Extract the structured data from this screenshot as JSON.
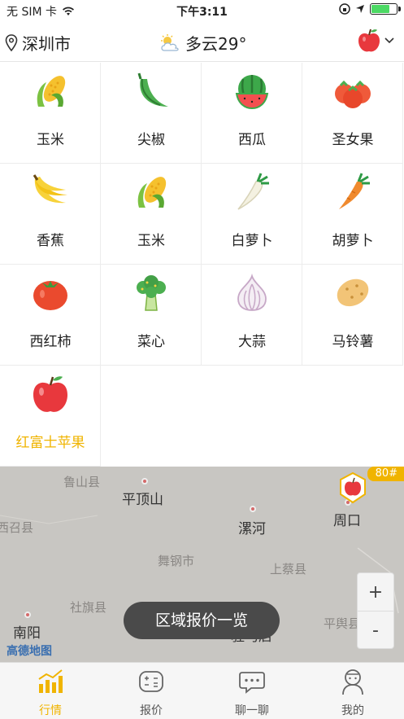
{
  "status_bar": {
    "carrier": "无 SIM 卡",
    "time": "下午3:11"
  },
  "header": {
    "location": "深圳市",
    "weather": "多云29°",
    "fruit_icon": "apple-icon"
  },
  "products": [
    {
      "label": "玉米",
      "icon": "corn-icon"
    },
    {
      "label": "尖椒",
      "icon": "pepper-icon"
    },
    {
      "label": "西瓜",
      "icon": "watermelon-icon"
    },
    {
      "label": "圣女果",
      "icon": "cherry-tomato-icon"
    },
    {
      "label": "香蕉",
      "icon": "banana-icon"
    },
    {
      "label": "玉米",
      "icon": "corn-icon"
    },
    {
      "label": "白萝卜",
      "icon": "radish-icon"
    },
    {
      "label": "胡萝卜",
      "icon": "carrot-icon"
    },
    {
      "label": "西红柿",
      "icon": "tomato-icon"
    },
    {
      "label": "菜心",
      "icon": "broccoli-icon"
    },
    {
      "label": "大蒜",
      "icon": "garlic-icon"
    },
    {
      "label": "马铃薯",
      "icon": "potato-icon"
    },
    {
      "label": "红富士苹果",
      "icon": "apple-icon",
      "selected": true
    }
  ],
  "map": {
    "cities": [
      "鲁山县",
      "平顶山",
      "漯河",
      "周口",
      "西召县",
      "舞钢市",
      "上蔡县",
      "社旗县",
      "南阳",
      "驻马店",
      "平舆县"
    ],
    "badge": "80#",
    "region_button": "区域报价一览",
    "attribution": "高德地图",
    "zoom_in": "+",
    "zoom_out": "-"
  },
  "tabs": [
    {
      "label": "行情",
      "icon": "chart-icon",
      "active": true
    },
    {
      "label": "报价",
      "icon": "calculator-icon"
    },
    {
      "label": "聊一聊",
      "icon": "chat-icon"
    },
    {
      "label": "我的",
      "icon": "user-icon"
    }
  ],
  "colors": {
    "accent": "#f0b400",
    "map_bg": "#c8c6c2"
  }
}
